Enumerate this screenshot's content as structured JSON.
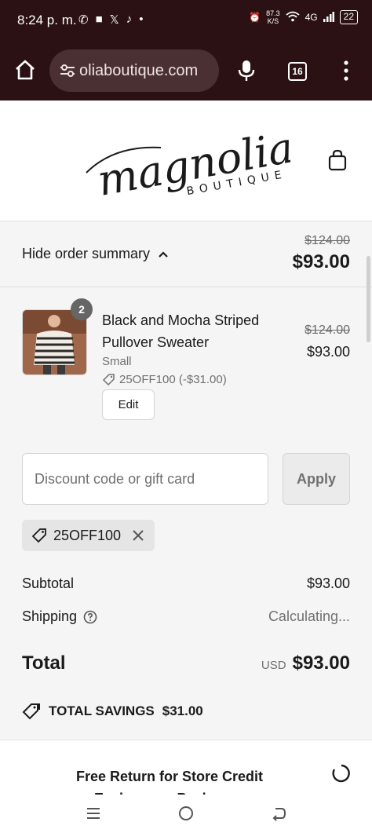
{
  "status_bar": {
    "time": "8:24 p. m.",
    "net_speed_value": "87.3",
    "net_speed_unit": "K/S",
    "network": "4G",
    "battery": "22"
  },
  "browser": {
    "url": "oliaboutique.com",
    "tab_count": "16"
  },
  "site": {
    "logo_script": "magnolia",
    "logo_sub": "BOUTIQUE"
  },
  "order_summary": {
    "toggle_label": "Hide order summary",
    "original_total": "$124.00",
    "total": "$93.00"
  },
  "product": {
    "quantity": "2",
    "name": "Black and Mocha Striped Pullover Sweater",
    "variant": "Small",
    "discount": "25OFF100 (-$31.00)",
    "edit_label": "Edit",
    "original_price": "$124.00",
    "price": "$93.00"
  },
  "discount": {
    "placeholder": "Discount code or gift card",
    "apply_label": "Apply",
    "applied_code": "25OFF100"
  },
  "totals": {
    "subtotal_label": "Subtotal",
    "subtotal_value": "$93.00",
    "shipping_label": "Shipping",
    "shipping_value": "Calculating...",
    "total_label": "Total",
    "currency": "USD",
    "total_value": "$93.00"
  },
  "savings": {
    "label": "TOTAL SAVINGS",
    "amount": "$31.00"
  },
  "promo": {
    "text": "Free Return for Store Credit or Exchange + Package Protection for"
  },
  "colors": {
    "browser_bar": "#2b1113",
    "summary_bg": "#f5f5f5"
  }
}
